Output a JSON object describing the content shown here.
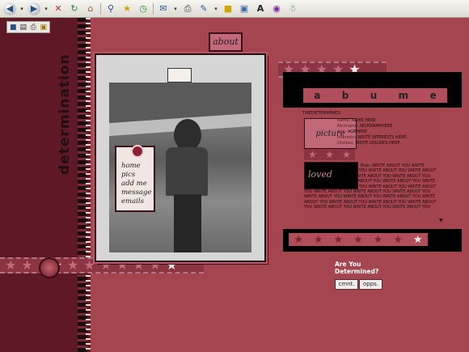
{
  "toolbar": {
    "icons": [
      "back-icon",
      "forward-icon",
      "stop-icon",
      "refresh-icon",
      "home-icon",
      "search-icon",
      "favorites-icon",
      "history-icon",
      "mail-icon",
      "print-icon",
      "edit-icon",
      "discuss-icon",
      "messenger-icon",
      "font-icon",
      "extra-icon",
      "msn-icon"
    ]
  },
  "mini_toolbar": {
    "icons": [
      "save-icon",
      "copy-icon",
      "print-icon",
      "lock-icon"
    ]
  },
  "sidebar": {
    "word": "determination"
  },
  "photo_panel": {
    "about_tag": "about",
    "nav_links": [
      "home",
      "pics",
      "add me",
      "message",
      "emails"
    ]
  },
  "profile": {
    "name_letters": [
      "a",
      "b",
      "u",
      "m",
      "e"
    ],
    "section_label": "THEDETERMINED",
    "picture_label": "picture",
    "loved_label": "loved",
    "facts": [
      {
        "label": "Name:",
        "value": "NAME HERE"
      },
      {
        "label": "Nickname:",
        "value": "NICKNAMEHERE"
      },
      {
        "label": "Age:",
        "value": "AGEHERE"
      },
      {
        "label": "Interests:",
        "value": "WRITE INTERESTS HERE."
      },
      {
        "label": "Dislikes:",
        "value": "WRITE DISLIKES HERE."
      }
    ],
    "about_text": "Blah. WRITE ABOUT YOU WRITE ABOUT YOU WRITE ABOUT YOU WRITE ABOUT YOU WRITE ABOUT YOU WRITE ABOUT YOU WRITE ABOUT YOU WRITE ABOUT YOU WRITE ABOUT YOU WRITE ABOUT YOU WRITE ABOUT YOU WRITE ABOUT YOU WRITE ABOUT YOU WRITE ABOUT YOU WRITE ABOUT YOU WRITE ABOUT YOU WRITE ABOUT YOU WRITE ABOUT YOU WRITE ABOUT YOU WRITE ABOUT YOU WRITE ABOUT YOU WRITE ABOUT YOU WRITE ABOUT YOU WRITE ABOUT YOU WRITE ABOUT YOU WRITE ABOUT YOU WRITE ABOUT YOU WRITE ABOUT YOU"
  },
  "footer": {
    "question_line1": "Are You",
    "question_line2": "Determined?",
    "buttons": [
      "cmnt.",
      "opps."
    ]
  },
  "colors": {
    "background": "#a5454f",
    "left_band": "#5e1826",
    "accent": "#b24e5c"
  }
}
